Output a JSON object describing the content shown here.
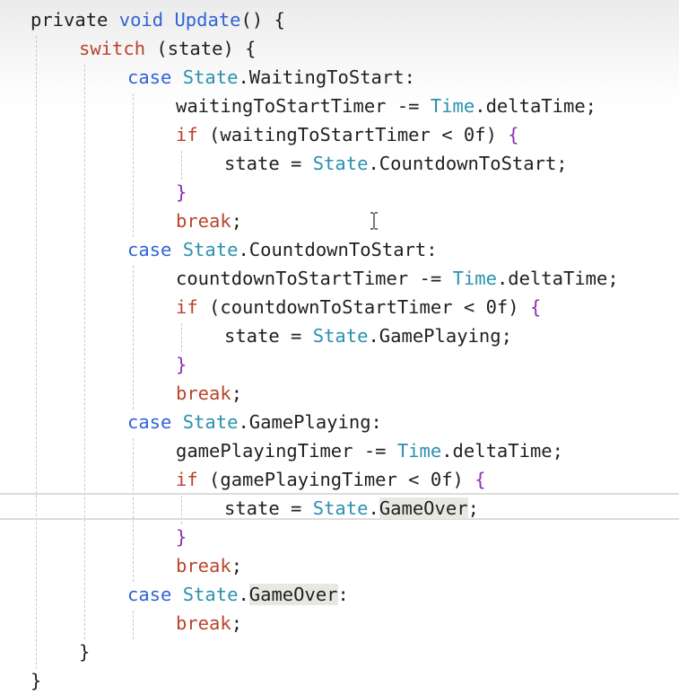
{
  "code": {
    "lines": [
      [
        {
          "t": "private ",
          "c": "ident"
        },
        {
          "t": "void ",
          "c": "kw-blue"
        },
        {
          "t": "Update",
          "c": "kw-blue"
        },
        {
          "t": "() {",
          "c": "ident"
        }
      ],
      [
        {
          "t": "switch",
          "c": "kw-red"
        },
        {
          "t": " (state) {",
          "c": "ident"
        }
      ],
      [
        {
          "t": "case ",
          "c": "kw-blue"
        },
        {
          "t": "State",
          "c": "type"
        },
        {
          "t": ".WaitingToStart:",
          "c": "ident"
        }
      ],
      [
        {
          "t": "waitingToStartTimer -= ",
          "c": "ident"
        },
        {
          "t": "Time",
          "c": "type"
        },
        {
          "t": ".deltaTime;",
          "c": "ident"
        }
      ],
      [
        {
          "t": "if",
          "c": "kw-red"
        },
        {
          "t": " (waitingToStartTimer < 0f) ",
          "c": "ident"
        },
        {
          "t": "{",
          "c": "kw-purple"
        }
      ],
      [
        {
          "t": "state = ",
          "c": "ident"
        },
        {
          "t": "State",
          "c": "type"
        },
        {
          "t": ".CountdownToStart;",
          "c": "ident"
        }
      ],
      [
        {
          "t": "}",
          "c": "kw-purple"
        }
      ],
      [
        {
          "t": "break",
          "c": "kw-red"
        },
        {
          "t": ";",
          "c": "ident"
        }
      ],
      [
        {
          "t": "case ",
          "c": "kw-blue"
        },
        {
          "t": "State",
          "c": "type"
        },
        {
          "t": ".CountdownToStart:",
          "c": "ident"
        }
      ],
      [
        {
          "t": "countdownToStartTimer -= ",
          "c": "ident"
        },
        {
          "t": "Time",
          "c": "type"
        },
        {
          "t": ".deltaTime;",
          "c": "ident"
        }
      ],
      [
        {
          "t": "if",
          "c": "kw-red"
        },
        {
          "t": " (countdownToStartTimer < 0f) ",
          "c": "ident"
        },
        {
          "t": "{",
          "c": "kw-purple"
        }
      ],
      [
        {
          "t": "state = ",
          "c": "ident"
        },
        {
          "t": "State",
          "c": "type"
        },
        {
          "t": ".GamePlaying;",
          "c": "ident"
        }
      ],
      [
        {
          "t": "}",
          "c": "kw-purple"
        }
      ],
      [
        {
          "t": "break",
          "c": "kw-red"
        },
        {
          "t": ";",
          "c": "ident"
        }
      ],
      [
        {
          "t": "case ",
          "c": "kw-blue"
        },
        {
          "t": "State",
          "c": "type"
        },
        {
          "t": ".GamePlaying:",
          "c": "ident"
        }
      ],
      [
        {
          "t": "gamePlayingTimer -= ",
          "c": "ident"
        },
        {
          "t": "Time",
          "c": "type"
        },
        {
          "t": ".deltaTime;",
          "c": "ident"
        }
      ],
      [
        {
          "t": "if",
          "c": "kw-red"
        },
        {
          "t": " (gamePlayingTimer < 0f) ",
          "c": "ident"
        },
        {
          "t": "{",
          "c": "kw-purple"
        }
      ],
      [
        {
          "t": "state = ",
          "c": "ident"
        },
        {
          "t": "State",
          "c": "type"
        },
        {
          "t": ".",
          "c": "ident"
        },
        {
          "t": "GameOver",
          "c": "ident hl"
        },
        {
          "t": ";",
          "c": "ident"
        }
      ],
      [
        {
          "t": "}",
          "c": "kw-purple"
        }
      ],
      [
        {
          "t": "break",
          "c": "kw-red"
        },
        {
          "t": ";",
          "c": "ident"
        }
      ],
      [
        {
          "t": "case ",
          "c": "kw-blue"
        },
        {
          "t": "State",
          "c": "type"
        },
        {
          "t": ".",
          "c": "ident"
        },
        {
          "t": "GameOver",
          "c": "ident hl"
        },
        {
          "t": ":",
          "c": "ident"
        }
      ],
      [
        {
          "t": "break",
          "c": "kw-red"
        },
        {
          "t": ";",
          "c": "ident"
        }
      ],
      [
        {
          "t": "}",
          "c": "ident"
        }
      ],
      [
        {
          "t": "}",
          "c": "ident"
        }
      ]
    ],
    "current_line_index": 17
  },
  "colors": {
    "keyword_blue": "#2f63d6",
    "keyword_red": "#b8442c",
    "brace_purple": "#8a2fb5",
    "type_teal": "#2b91af",
    "text": "#1f1f1f"
  },
  "cursor_icon": "i-beam-cursor-icon"
}
